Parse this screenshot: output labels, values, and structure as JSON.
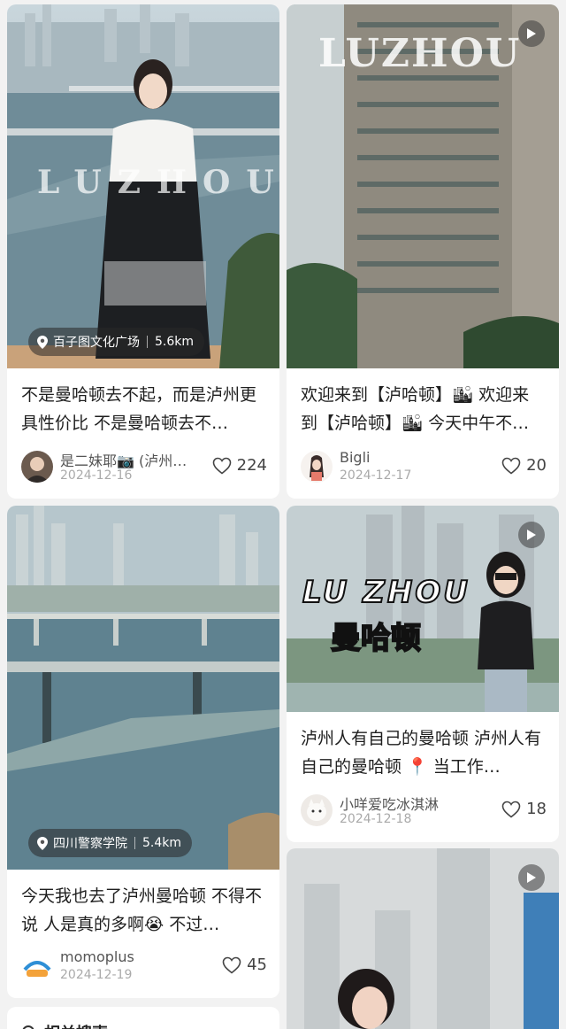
{
  "cards": [
    {
      "title": "不是曼哈顿去不起，而是泸州更具性价比 不是曼哈顿去不…",
      "location": "百子图文化广场",
      "distance": "5.6km",
      "author": "是二妹耶📷 (泸州…",
      "date": "2024-12-16",
      "likes": "224",
      "overlay": "LUZHOU",
      "has_play": false
    },
    {
      "title": "欢迎来到【泸哈顿】🏙 欢迎来到【泸哈顿】🏙 今天中午不…",
      "author": "Bigli",
      "date": "2024-12-17",
      "likes": "20",
      "overlay": "LUZHOU",
      "has_play": true
    },
    {
      "title": "今天我也去了泸州曼哈顿 不得不说 人是真的多啊😭 不过…",
      "location": "四川警察学院",
      "distance": "5.4km",
      "author": "momoplus",
      "date": "2024-12-19",
      "likes": "45",
      "has_play": false
    },
    {
      "title": "泸州人有自己的曼哈顿 泸州人有自己的曼哈顿 📍 当工作…",
      "author": "小咩爱吃冰淇淋",
      "date": "2024-12-18",
      "likes": "18",
      "overlay_line1": "LU ZHOU",
      "overlay_line2": "曼哈顿",
      "has_play": true
    },
    {
      "has_play": true
    }
  ],
  "bottom_partial": "相关搜索",
  "icons": {
    "play": "play-icon",
    "location": "location-pin-icon",
    "like": "heart-icon"
  },
  "colors": {
    "card_bg": "#ffffff",
    "page_bg": "#f2f2f2",
    "text": "#1f1f1f",
    "muted": "#aaaaaa"
  }
}
